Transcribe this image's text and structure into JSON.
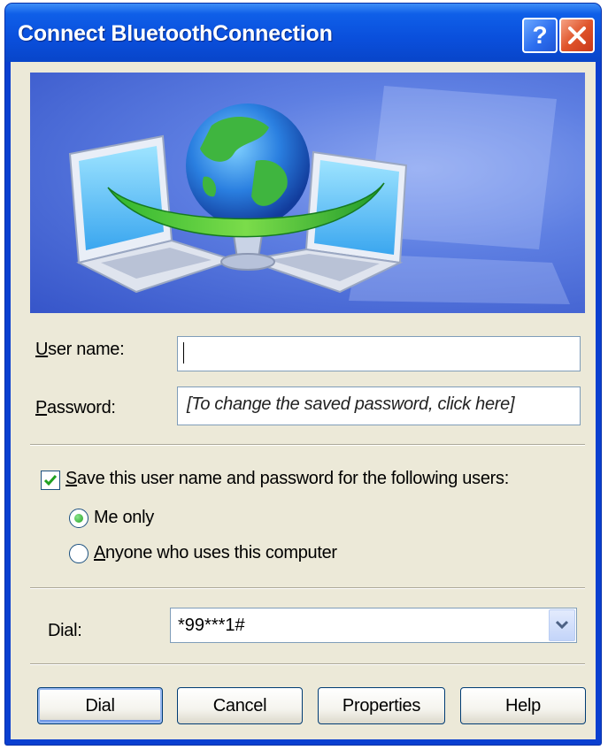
{
  "window": {
    "title": "Connect BluetoothConnection",
    "help_glyph": "?",
    "close_icon": "close-icon"
  },
  "form": {
    "username_label": "User name:",
    "username_value": "",
    "password_label": "Password:",
    "password_value": "[To change the saved password, click here]",
    "save_label": "Save this user name and password for the following users:",
    "save_checked": true,
    "options": [
      {
        "label": "Me only",
        "selected": true
      },
      {
        "label": "Anyone who uses this computer",
        "selected": false
      }
    ],
    "dial_label": "Dial:",
    "dial_value": "*99***1#"
  },
  "buttons": {
    "dial": "Dial",
    "cancel": "Cancel",
    "properties": "Properties",
    "help": "Help"
  },
  "colors": {
    "titlebar": "#0a4fdc",
    "client": "#ece9d8",
    "close_button": "#e0552b",
    "radio_dot": "#21a121"
  }
}
